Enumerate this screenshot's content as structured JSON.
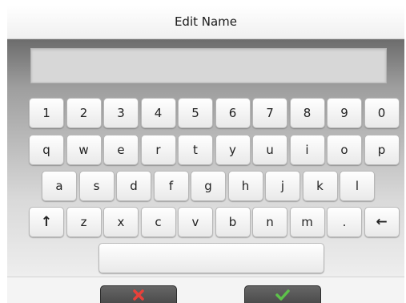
{
  "title": "Edit Name",
  "name_field": {
    "value": ""
  },
  "keyboard": {
    "row1": [
      "1",
      "2",
      "3",
      "4",
      "5",
      "6",
      "7",
      "8",
      "9",
      "0"
    ],
    "row2": [
      "q",
      "w",
      "e",
      "r",
      "t",
      "y",
      "u",
      "i",
      "o",
      "p"
    ],
    "row3": [
      "a",
      "s",
      "d",
      "f",
      "g",
      "h",
      "j",
      "k",
      "l"
    ],
    "row4": [
      "↑",
      "z",
      "x",
      "c",
      "v",
      "b",
      "n",
      "m",
      ".",
      "←"
    ],
    "space": ""
  },
  "actions": {
    "cancel_icon": "red-x-icon",
    "confirm_icon": "green-checkmark-icon",
    "cancel_color": "#e8413a",
    "confirm_color": "#5dc24a"
  }
}
